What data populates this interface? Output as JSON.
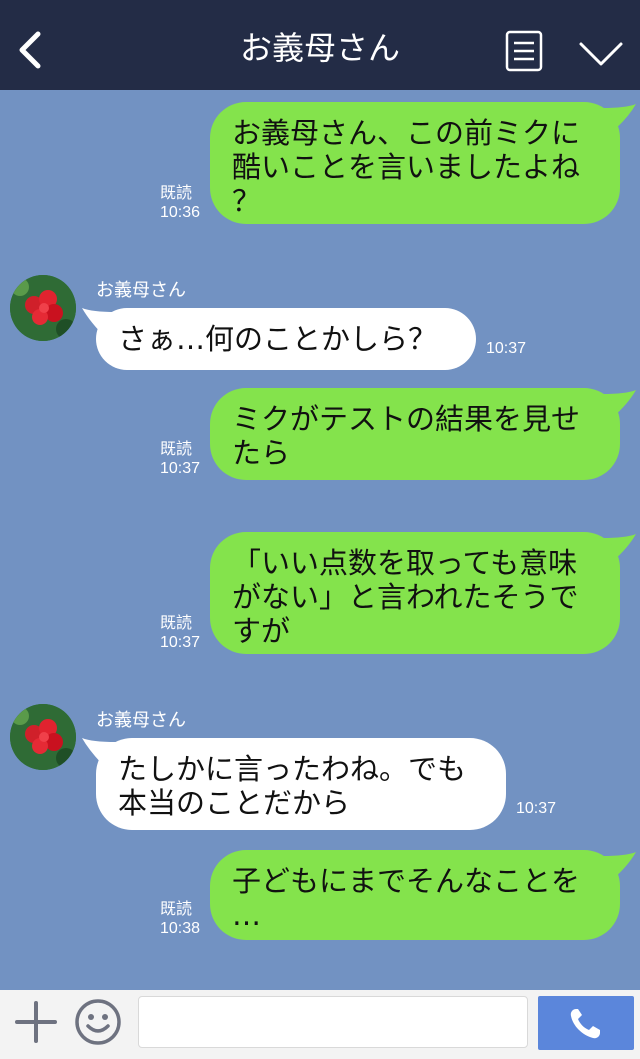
{
  "header": {
    "title": "お義母さん",
    "icons": [
      "back-chevron-icon",
      "menu-list-icon",
      "collapse-chevron-icon"
    ],
    "bg_color": "#232c46"
  },
  "chat": {
    "bg_color": "#7292c2",
    "messages": [
      {
        "direction": "out",
        "text": "お義母さん、この前ミクに\n酷いことを言いましたよね\n？",
        "read": "既読",
        "time": "10:36"
      },
      {
        "direction": "in",
        "sender": "お義母さん",
        "text": "さぁ…何のことかしら？",
        "time": "10:37"
      },
      {
        "direction": "out",
        "text": "ミクがテストの結果を見せ\nたら",
        "read": "既読",
        "time": "10:37"
      },
      {
        "direction": "out",
        "text": "「いい点数を取っても意味\nがない」と言われたそうで\nすが",
        "read": "既読",
        "time": "10:37"
      },
      {
        "direction": "in",
        "sender": "お義母さん",
        "text": "たしかに言ったわね。でも\n本当のことだから",
        "time": "10:37"
      },
      {
        "direction": "out",
        "text": "子どもにまでそんなことを\n…",
        "read": "既読",
        "time": "10:38"
      }
    ],
    "colors": {
      "outgoing": "#84e34c",
      "incoming": "#ffffff"
    }
  },
  "footer": {
    "icons": [
      "plus-icon",
      "emoji-icon",
      "phone-icon"
    ],
    "input_value": "",
    "call_color": "#5b86db"
  }
}
